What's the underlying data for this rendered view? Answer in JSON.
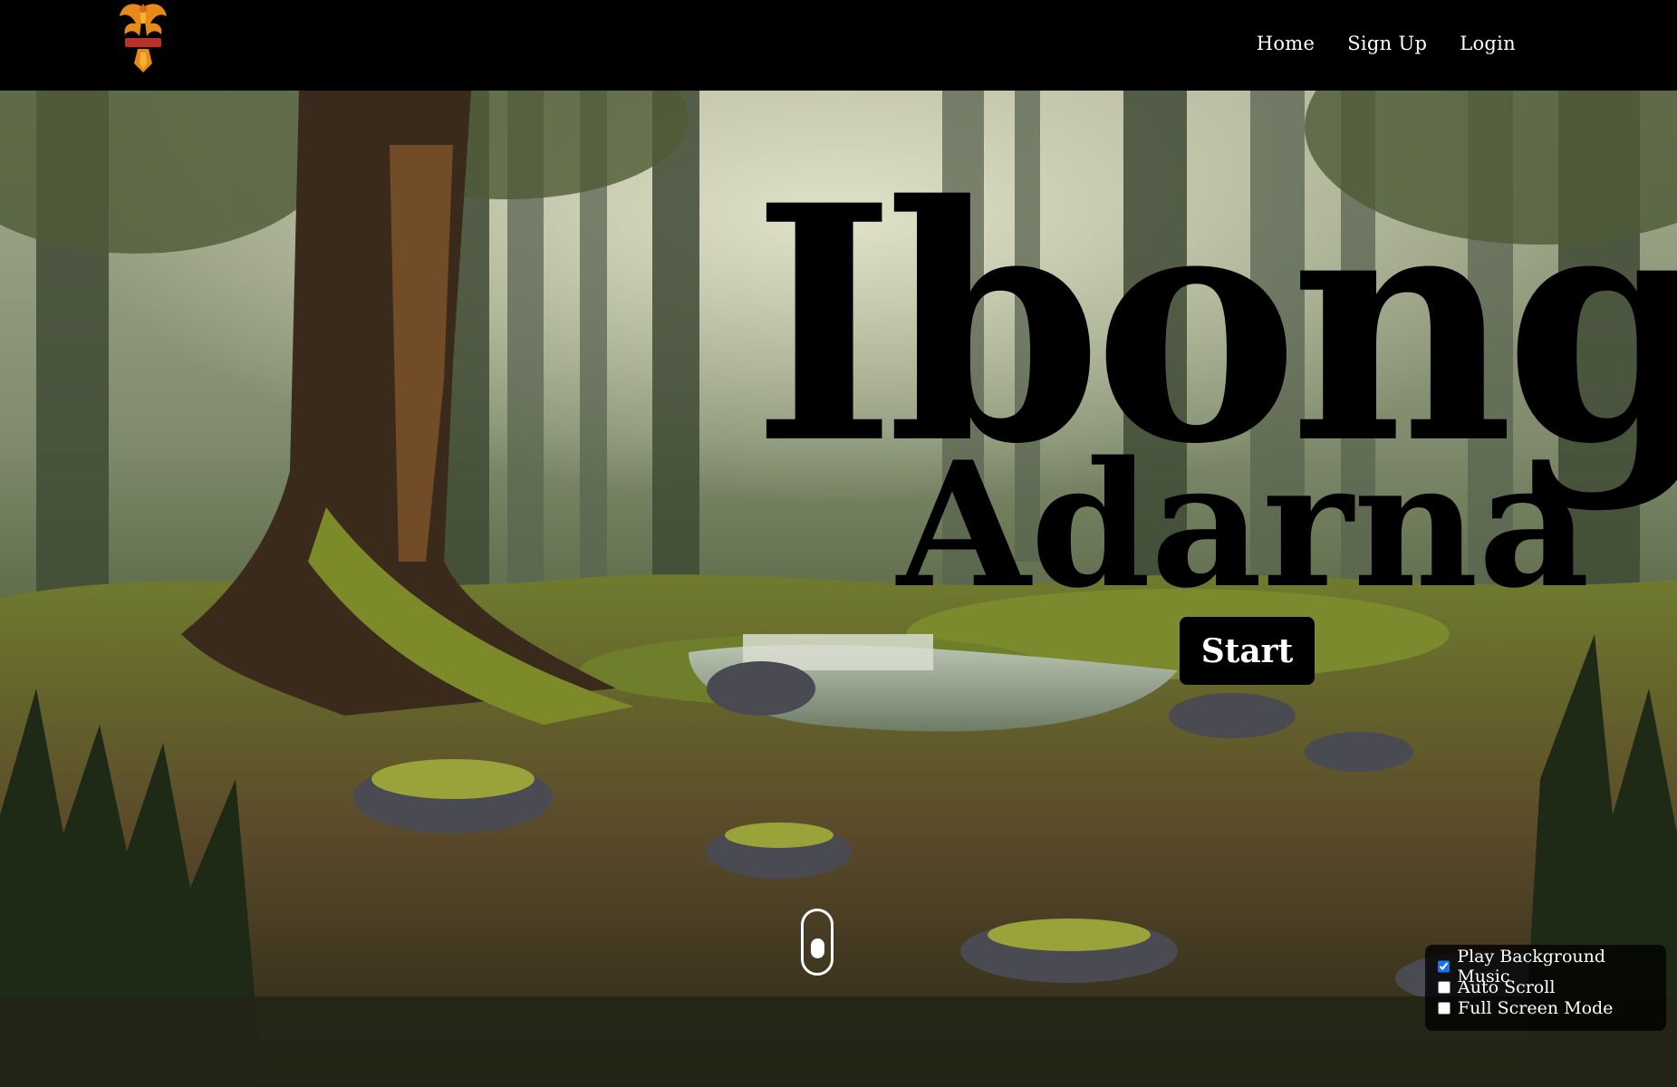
{
  "nav": {
    "logo_text": "IBONG ADARNA",
    "links": [
      "Home",
      "Sign Up",
      "Login"
    ]
  },
  "hero": {
    "title_line1": "Ibong",
    "title_line2": "Adarna",
    "start_label": "Start"
  },
  "settings": {
    "items": [
      {
        "label": "Play Background Music",
        "checked": true
      },
      {
        "label": "Auto Scroll",
        "checked": false
      },
      {
        "label": "Full Screen Mode",
        "checked": false
      }
    ]
  },
  "colors": {
    "nav_bg": "#000000",
    "title": "#000000",
    "button_bg": "#000000",
    "checkbox_accent": "#1a73e8"
  }
}
